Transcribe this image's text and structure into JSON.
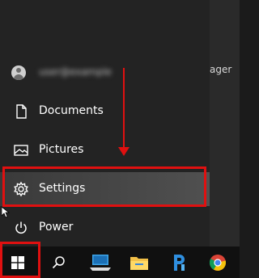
{
  "start_menu": {
    "user": {
      "name": "user@example"
    },
    "items": [
      {
        "label": "Documents",
        "icon": "document-icon"
      },
      {
        "label": "Pictures",
        "icon": "pictures-icon"
      },
      {
        "label": "Settings",
        "icon": "gear-icon"
      },
      {
        "label": "Power",
        "icon": "power-icon"
      }
    ]
  },
  "desktop": {
    "partial_text": "ager"
  },
  "taskbar": {
    "buttons": [
      {
        "icon": "windows-start-icon"
      },
      {
        "icon": "search-icon"
      },
      {
        "icon": "this-pc-icon"
      },
      {
        "icon": "file-explorer-icon"
      },
      {
        "icon": "pd-app-icon"
      },
      {
        "icon": "chrome-icon"
      }
    ]
  },
  "annotations": {
    "highlight_color": "#e01010"
  }
}
